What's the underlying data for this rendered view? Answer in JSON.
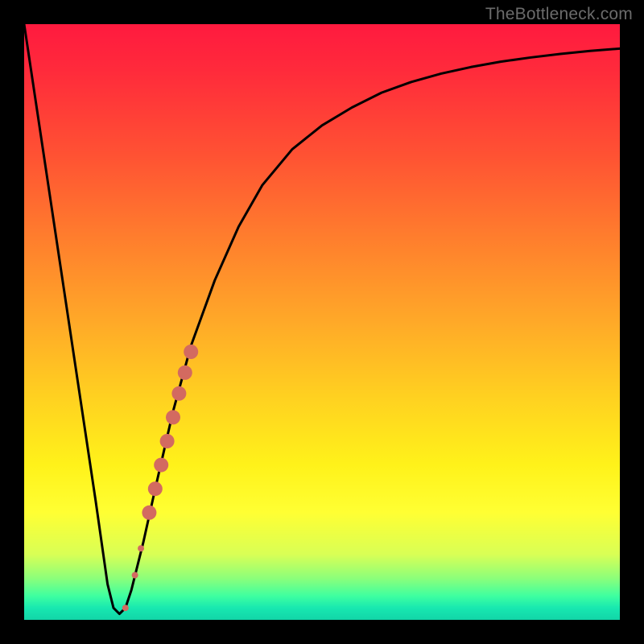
{
  "watermark": "TheBottleneck.com",
  "chart_data": {
    "type": "line",
    "title": "",
    "xlabel": "",
    "ylabel": "",
    "xlim": [
      0,
      100
    ],
    "ylim": [
      0,
      100
    ],
    "series": [
      {
        "name": "curve",
        "x": [
          0,
          3,
          6,
          9,
          12,
          14,
          15,
          16,
          17,
          18,
          20,
          22,
          25,
          28,
          32,
          36,
          40,
          45,
          50,
          55,
          60,
          65,
          70,
          75,
          80,
          85,
          90,
          95,
          100
        ],
        "y": [
          100,
          80,
          60,
          40,
          20,
          6,
          2,
          1,
          2,
          5,
          13,
          22,
          35,
          46,
          57,
          66,
          73,
          79,
          83,
          86,
          88.5,
          90.3,
          91.7,
          92.8,
          93.7,
          94.4,
          95.0,
          95.5,
          95.9
        ]
      }
    ],
    "markers": [
      {
        "x": 17.0,
        "y": 2.0,
        "r": 4
      },
      {
        "x": 18.6,
        "y": 7.5,
        "r": 4
      },
      {
        "x": 19.6,
        "y": 12.0,
        "r": 4
      },
      {
        "x": 21.0,
        "y": 18.0,
        "r": 9
      },
      {
        "x": 22.0,
        "y": 22.0,
        "r": 9
      },
      {
        "x": 23.0,
        "y": 26.0,
        "r": 9
      },
      {
        "x": 24.0,
        "y": 30.0,
        "r": 9
      },
      {
        "x": 25.0,
        "y": 34.0,
        "r": 9
      },
      {
        "x": 26.0,
        "y": 38.0,
        "r": 9
      },
      {
        "x": 27.0,
        "y": 41.5,
        "r": 9
      },
      {
        "x": 28.0,
        "y": 45.0,
        "r": 9
      }
    ],
    "marker_color": "#d36a60",
    "curve_color": "#000000"
  }
}
